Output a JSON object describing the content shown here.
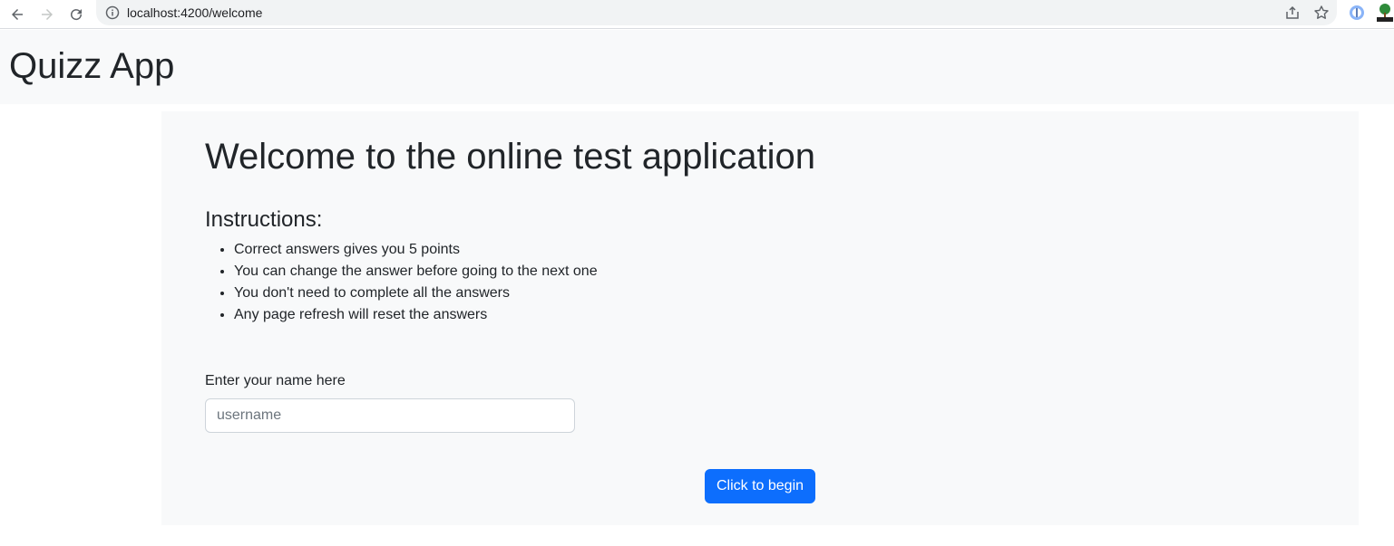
{
  "browser": {
    "url": "localhost:4200/welcome",
    "icons": [
      "back-arrow-icon",
      "forward-arrow-icon",
      "reload-icon",
      "info-icon",
      "share-icon",
      "star-icon",
      "extension-icon",
      "extension-tree-icon"
    ]
  },
  "header": {
    "title": "Quizz App"
  },
  "main": {
    "title": "Welcome to the online test application",
    "instructions_heading": "Instructions:",
    "instructions": [
      "Correct answers gives you 5 points",
      "You can change the answer before going to the next one",
      "You don't need to complete all the answers",
      "Any page refresh will reset the answers"
    ],
    "name_label": "Enter your name here",
    "name_placeholder": "username",
    "begin_label": "Click to begin"
  },
  "colors": {
    "primary": "#0d6efd",
    "panel_bg": "#f8f9fa",
    "text": "#212529"
  }
}
